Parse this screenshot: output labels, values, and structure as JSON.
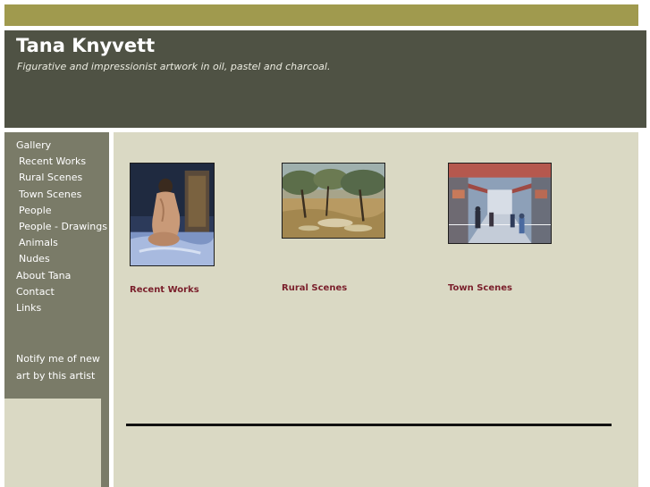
{
  "header": {
    "title": "Tana Knyvett",
    "tagline": "Figurative and impressionist artwork in oil, pastel and charcoal."
  },
  "sidebar": {
    "items": [
      {
        "label": "Gallery"
      },
      {
        "label": "Recent Works"
      },
      {
        "label": "Rural Scenes"
      },
      {
        "label": "Town Scenes"
      },
      {
        "label": "People"
      },
      {
        "label": "People - Drawings"
      },
      {
        "label": "Animals"
      },
      {
        "label": "Nudes"
      },
      {
        "label": "About Tana"
      },
      {
        "label": "Contact"
      },
      {
        "label": "Links"
      }
    ],
    "notify_label": "Notify me of new art by this artist"
  },
  "gallery": {
    "items": [
      {
        "caption": "Recent Works",
        "image": "nude-figure-painting"
      },
      {
        "caption": "Rural Scenes",
        "image": "olive-grove-painting"
      },
      {
        "caption": "Town Scenes",
        "image": "arcade-street-painting"
      }
    ]
  },
  "colors": {
    "top_bar": "#a09a4e",
    "header_bg": "#4f5244",
    "sidebar_bg": "#7a7b68",
    "content_bg": "#dad9c4",
    "caption_link": "#7a1f2b"
  }
}
